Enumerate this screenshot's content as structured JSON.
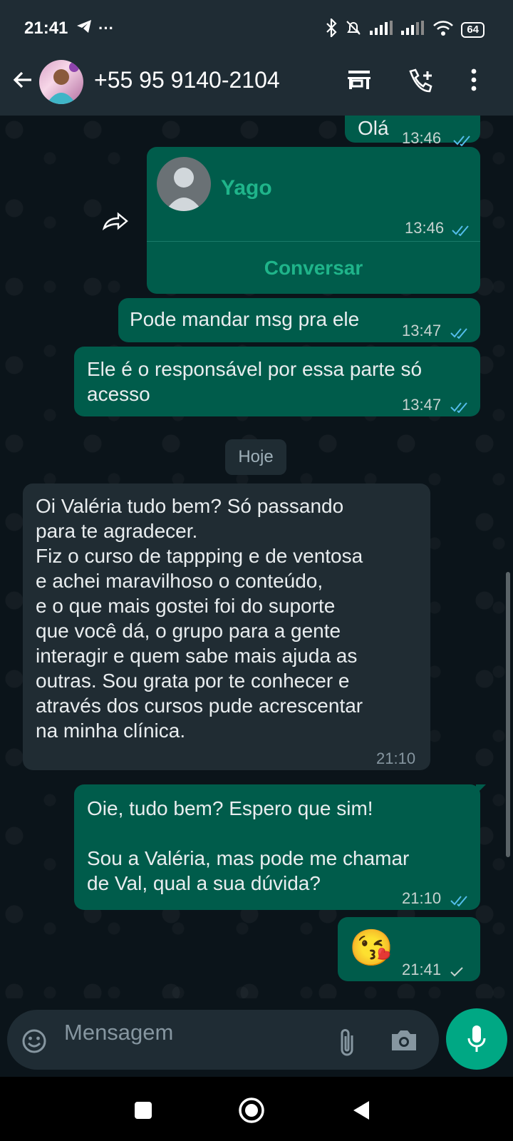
{
  "status_bar": {
    "time": "21:41",
    "battery": "64",
    "icons": [
      "telegram-icon",
      "more-dots-icon",
      "bluetooth-icon",
      "muted-bell-icon",
      "signal-icon",
      "signal-icon",
      "wifi-icon",
      "battery-icon"
    ]
  },
  "header": {
    "contact": "+55 95 9140-2104",
    "icons": [
      "back-arrow-icon",
      "store-icon",
      "add-call-icon",
      "more-vert-icon"
    ]
  },
  "messages": {
    "m0": {
      "text": "Olá",
      "time": "13:46"
    },
    "contact_card": {
      "name": "Yago",
      "time": "13:46",
      "action": "Conversar"
    },
    "m1": {
      "text": "Pode mandar msg pra ele",
      "time": "13:47"
    },
    "m2": {
      "line1": "Ele é o responsável por essa parte só",
      "line2": "acesso",
      "time": "13:47"
    },
    "date_chip": "Hoje",
    "m3": {
      "lines": [
        "Oi Valéria tudo bem? Só passando",
        "para te agradecer.",
        "Fiz o curso de tappping e de ventosa",
        "e achei maravilhoso o conteúdo,",
        "e o que mais gostei foi do suporte",
        "que você dá, o grupo para a gente",
        "interagir e quem sabe mais ajuda as",
        "outras. Sou grata por te conhecer e",
        "através dos cursos pude acrescentar",
        "na minha clínica."
      ],
      "time": "21:10"
    },
    "m4": {
      "line1": "Oie, tudo bem? Espero que sim!",
      "line2": "Sou a Valéria, mas pode me chamar",
      "line3": "de Val, qual a sua dúvida?",
      "time": "21:10"
    },
    "m5": {
      "emoji": "😘",
      "time": "21:41"
    }
  },
  "input": {
    "placeholder": "Mensagem"
  },
  "colors": {
    "outgoing": "#005c4b",
    "incoming": "#202c33",
    "read_ticks": "#53bdeb",
    "accent": "#00a884",
    "header": "#1f2c34"
  }
}
